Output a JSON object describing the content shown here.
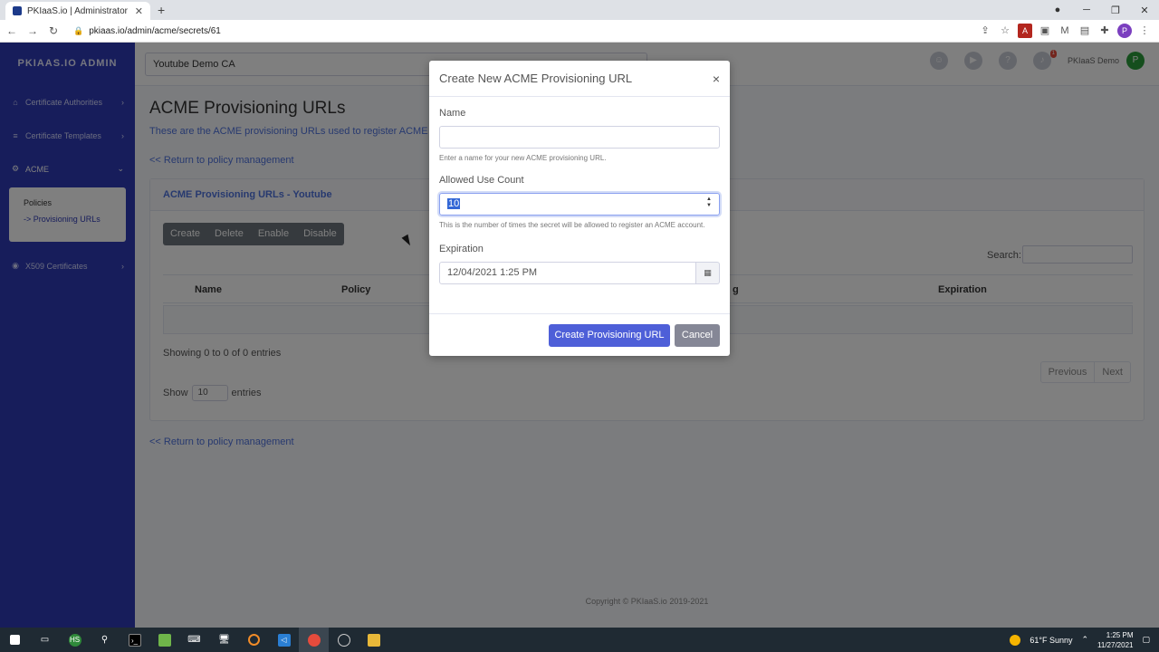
{
  "browser": {
    "tab_title": "PKIaaS.io | Administrator",
    "url": "pkiaas.io/admin/acme/secrets/61"
  },
  "sidebar": {
    "brand": "PKIAAS.IO ADMIN",
    "items": [
      {
        "label": "Certificate Authorities"
      },
      {
        "label": "Certificate Templates"
      },
      {
        "label": "ACME"
      },
      {
        "label": "X509 Certificates"
      }
    ],
    "acme_sub": [
      "Policies",
      "-> Provisioning URLs"
    ]
  },
  "topbar": {
    "ca_selector": "Youtube Demo CA",
    "notifications_count": "1",
    "user_name": "PKIaaS Demo",
    "user_initial": "P"
  },
  "page": {
    "title": "ACME Provisioning URLs",
    "subtitle": "These are the ACME provisioning URLs used to register ACME ac",
    "back_link": "<< Return to policy management",
    "card_title": "ACME Provisioning URLs - Youtube",
    "actions": [
      "Create",
      "Delete",
      "Enable",
      "Disable"
    ],
    "search_label": "Search:",
    "columns": [
      "Name",
      "Policy",
      "g",
      "Expiration"
    ],
    "info": "Showing 0 to 0 of 0 entries",
    "pager": [
      "Previous",
      "Next"
    ],
    "show_prefix": "Show",
    "show_value": "10",
    "show_suffix": "entries",
    "footer": "Copyright © PKIaaS.io 2019-2021"
  },
  "modal": {
    "title": "Create New ACME Provisioning URL",
    "name_label": "Name",
    "name_value": "",
    "name_help": "Enter a name for your new ACME provisioning URL.",
    "count_label": "Allowed Use Count",
    "count_value": "10",
    "count_help": "This is the number of times the secret will be allowed to register an ACME account.",
    "expiration_label": "Expiration",
    "expiration_value": "12/04/2021 1:25 PM",
    "submit_label": "Create Provisioning URL",
    "cancel_label": "Cancel"
  },
  "taskbar": {
    "weather": "61°F  Sunny",
    "time": "1:25 PM",
    "date": "11/27/2021"
  }
}
